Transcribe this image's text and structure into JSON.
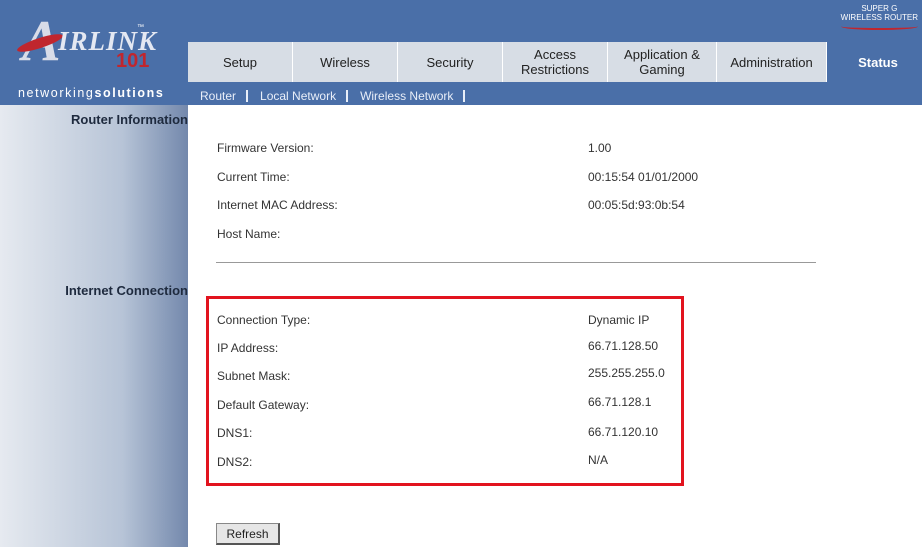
{
  "brand": {
    "logo_text": "IRLINK",
    "logo_number": "101",
    "tagline_a": "networking",
    "tagline_b": "solutions",
    "badge_line1": "SUPER G",
    "badge_line2": "WIRELESS ROUTER"
  },
  "tabs": [
    {
      "label": "Setup"
    },
    {
      "label": "Wireless"
    },
    {
      "label": "Security"
    },
    {
      "label": "Access Restrictions"
    },
    {
      "label": "Application & Gaming"
    },
    {
      "label": "Administration"
    },
    {
      "label": "Status"
    }
  ],
  "subnav": [
    {
      "label": "Router"
    },
    {
      "label": "Local Network"
    },
    {
      "label": "Wireless Network"
    }
  ],
  "sections": {
    "router_information": "Router Information",
    "internet_connection": "Internet Connection"
  },
  "router_info": [
    {
      "label": "Firmware Version:",
      "value": "1.00"
    },
    {
      "label": "Current Time:",
      "value": "00:15:54 01/01/2000"
    },
    {
      "label": "Internet MAC Address:",
      "value": "00:05:5d:93:0b:54"
    },
    {
      "label": "Host Name:",
      "value": ""
    }
  ],
  "internet_connection": [
    {
      "label": "Connection Type:",
      "value": "Dynamic IP"
    },
    {
      "label": "IP Address:",
      "value": "66.71.128.50"
    },
    {
      "label": "Subnet Mask:",
      "value": "255.255.255.0"
    },
    {
      "label": "Default Gateway:",
      "value": "66.71.128.1"
    },
    {
      "label": "DNS1:",
      "value": "66.71.120.10"
    },
    {
      "label": "DNS2:",
      "value": "N/A"
    }
  ],
  "buttons": {
    "refresh": "Refresh"
  },
  "colors": {
    "header": "#4a6fa8",
    "tab": "#d7dde5",
    "highlight": "#e2131e"
  }
}
